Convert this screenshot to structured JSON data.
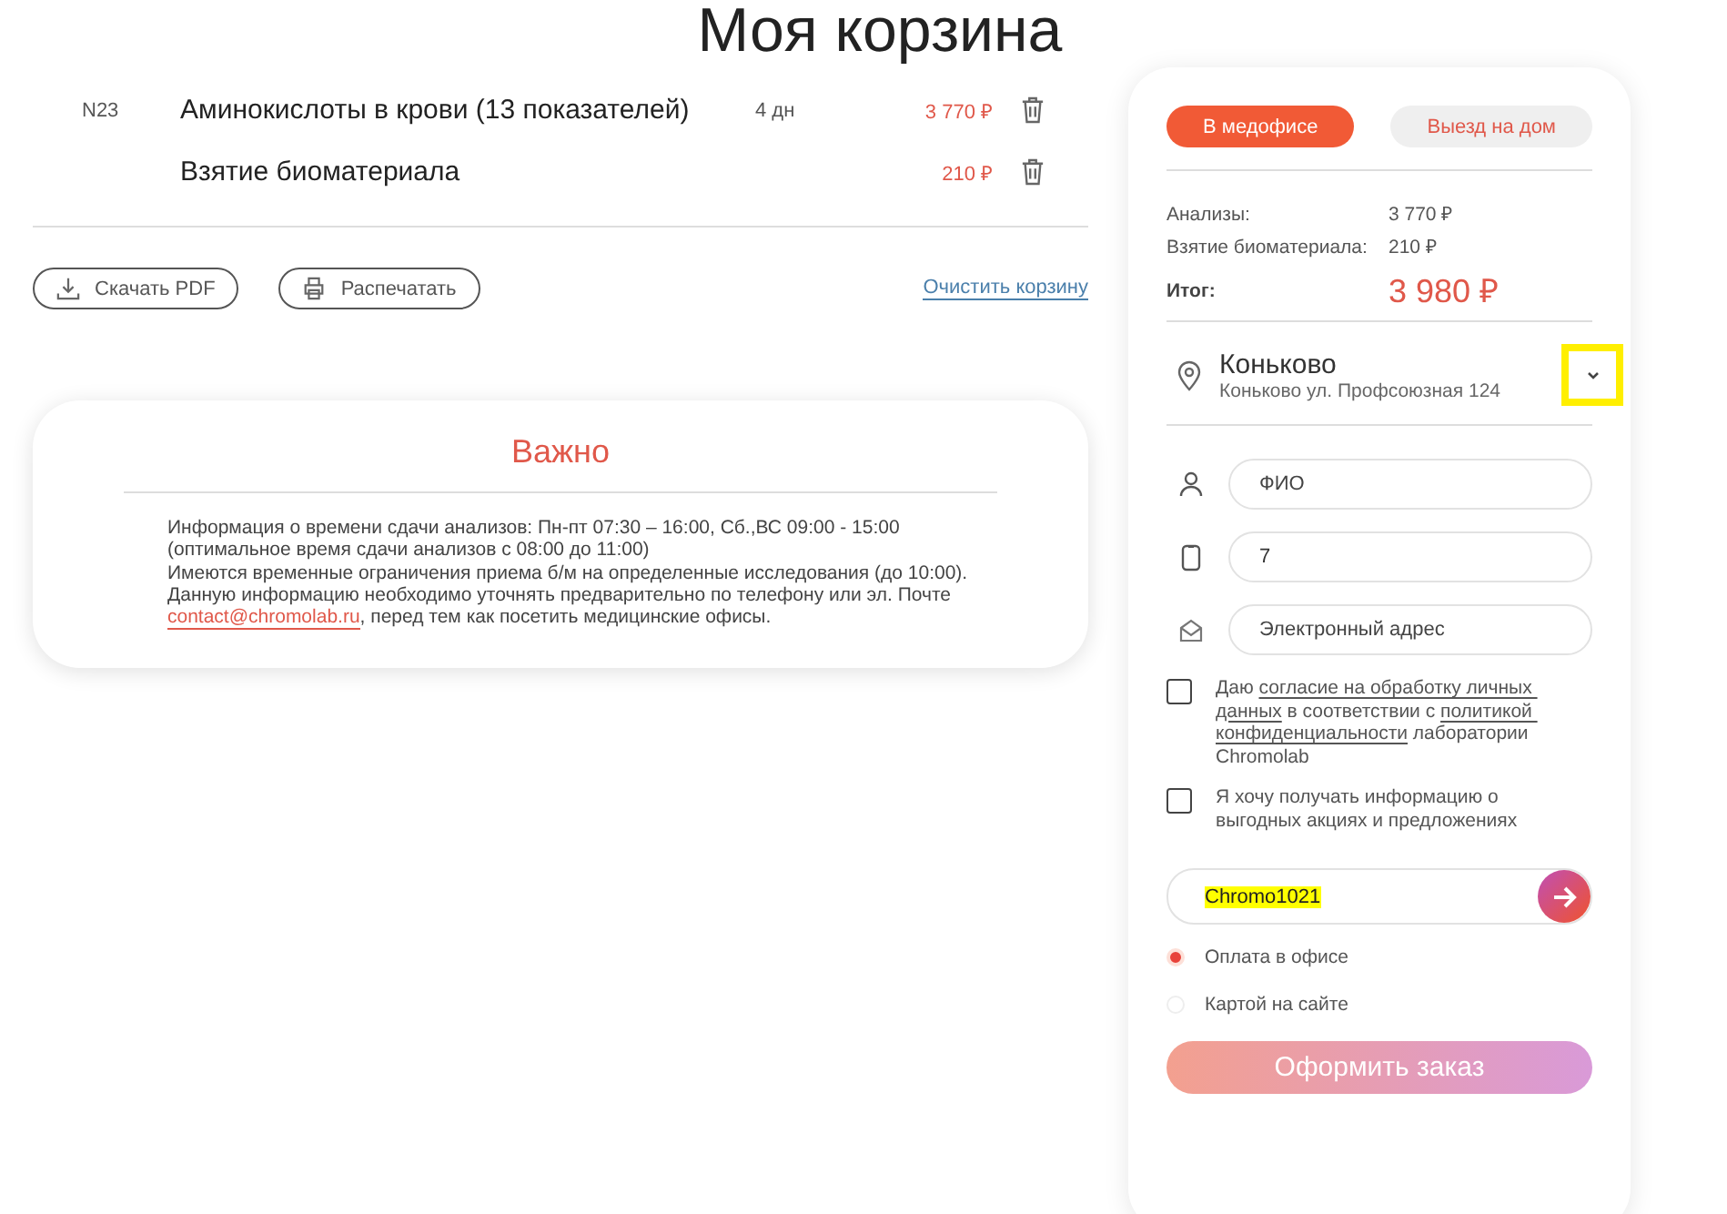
{
  "title": "Моя корзина",
  "cart_items": [
    {
      "code": "N23",
      "name": "Аминокислоты в крови (13 показателей)",
      "duration": "4 дн",
      "price": "3 770 ₽"
    },
    {
      "name": "Взятие биоматериала",
      "price": "210 ₽"
    }
  ],
  "actions": [
    {
      "kind": "download",
      "label": "Скачать PDF"
    },
    {
      "kind": "print",
      "label": "Распечатать"
    }
  ],
  "clear_link": "Очистить корзину",
  "notice": {
    "title": "Важно",
    "paragraphs": [
      {
        "text": "Информация о времени сдачи анализов: Пн-пт 07:30 – 16:00, Сб.,ВС 09:00 - 15:00 (оптимальное время сдачи анализов с 08:00 до 11:00)"
      },
      {
        "text": "Имеются временные ограничения приема б/м на определенные исследования (до 10:00). Данную информацию необходимо уточнять предварительно по телефону или эл. Почте ",
        "link": "contact@chromolab.ru",
        "after": ", перед тем как посетить медицинские офисы."
      }
    ]
  },
  "order": {
    "tabs": [
      {
        "label": "В медофисе",
        "selected": true
      },
      {
        "label": "Выезд на дом",
        "selected": false
      }
    ],
    "summary": [
      {
        "label": "Анализы:",
        "value": "3 770 ₽"
      },
      {
        "label": "Взятие биоматериала:",
        "value": "210 ₽"
      }
    ],
    "total": {
      "label": "Итог:",
      "value": "3 980 ₽"
    },
    "location": {
      "name": "Коньково",
      "address": "Коньково ул. Профсоюзная 124",
      "annotated": true
    },
    "fields": [
      {
        "kind": "person",
        "placeholder": "ФИО"
      },
      {
        "kind": "phone",
        "value": "7"
      },
      {
        "kind": "email",
        "placeholder": "Электронный адрес"
      }
    ],
    "checkboxes": [
      {
        "checked": false,
        "parts": [
          {
            "text": "Даю "
          },
          {
            "text": "согласие на обработку личных ",
            "link": true
          },
          {
            "text": "данных",
            "link": true
          },
          {
            "text": " в соответствии с "
          },
          {
            "text": "политикой ",
            "link": true
          },
          {
            "text": "конфиденциальности",
            "link": true
          },
          {
            "text": " лаборатории Chromolab"
          }
        ]
      },
      {
        "checked": false,
        "parts": [
          {
            "text": "Я хочу получать информацию о выгодных акциях и предложениях"
          }
        ]
      }
    ],
    "promo": {
      "value": "Chromo1021",
      "highlighted": true
    },
    "payment": [
      {
        "label": "Оплата в офисе",
        "selected": true
      },
      {
        "label": "Картой на сайте",
        "selected": false
      }
    ],
    "submit": {
      "label": "Оформить заказ",
      "disabled": true
    }
  }
}
